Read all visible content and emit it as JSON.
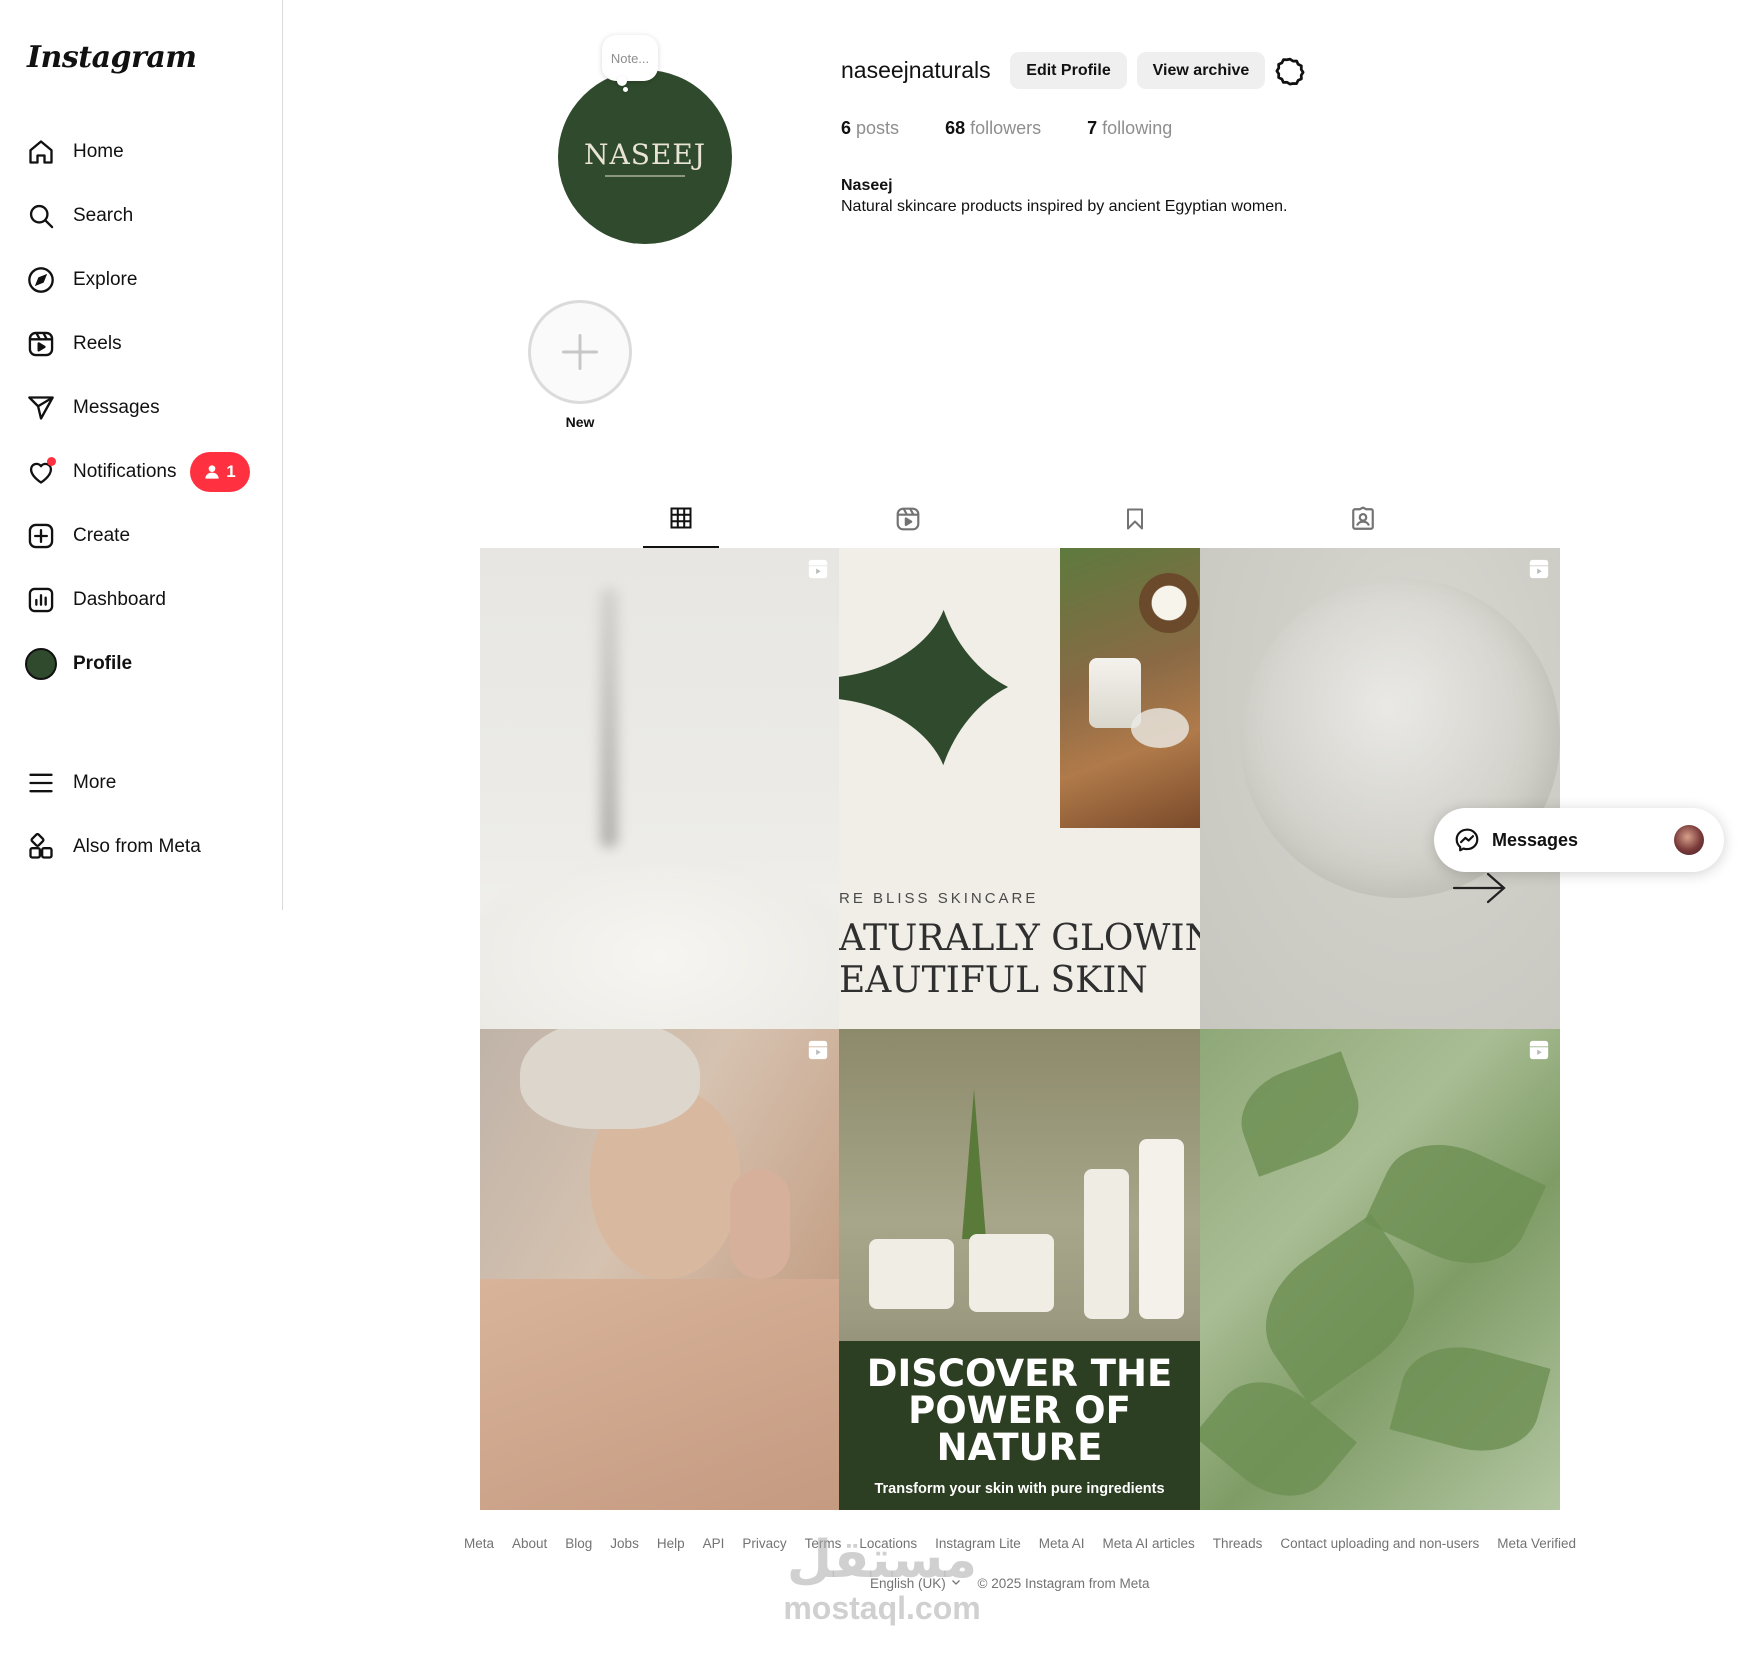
{
  "sidebar": {
    "logo": "Instagram",
    "items": [
      {
        "label": "Home",
        "icon": "home-icon"
      },
      {
        "label": "Search",
        "icon": "search-icon"
      },
      {
        "label": "Explore",
        "icon": "compass-icon"
      },
      {
        "label": "Reels",
        "icon": "reels-icon"
      },
      {
        "label": "Messages",
        "icon": "send-icon"
      },
      {
        "label": "Notifications",
        "icon": "heart-icon"
      },
      {
        "label": "Create",
        "icon": "plus-square-icon"
      },
      {
        "label": "Dashboard",
        "icon": "dashboard-icon"
      },
      {
        "label": "Profile",
        "icon": "avatar"
      }
    ],
    "notification_badge": "1",
    "more_label": "More",
    "also_from_meta_label": "Also from Meta"
  },
  "profile": {
    "note_placeholder": "Note...",
    "avatar_text": "NASEEJ",
    "username": "naseejnaturals",
    "edit_profile_label": "Edit Profile",
    "view_archive_label": "View archive",
    "posts_count": "6",
    "posts_label": "posts",
    "followers_count": "68",
    "followers_label": "followers",
    "following_count": "7",
    "following_label": "following",
    "display_name": "Naseej",
    "bio": "Natural skincare products inspired by ancient Egyptian women.",
    "highlight_new_label": "New"
  },
  "tabs": [
    {
      "name": "posts",
      "icon": "grid-icon",
      "active": true
    },
    {
      "name": "reels",
      "icon": "reels-icon",
      "active": false
    },
    {
      "name": "saved",
      "icon": "bookmark-icon",
      "active": false
    },
    {
      "name": "tagged",
      "icon": "tagged-user-icon",
      "active": false
    }
  ],
  "posts": {
    "post2_subtitle": "RE BLISS SKINCARE",
    "post2_heading_line1": "ATURALLY GLOWIN",
    "post2_heading_line2": "EAUTIFUL SKIN",
    "post5_title_line1": "DISCOVER THE",
    "post5_title_line2": "POWER OF",
    "post5_title_line3": "NATURE",
    "post5_subtitle": "Transform your skin with pure ingredients"
  },
  "messages_pill": {
    "label": "Messages"
  },
  "footer": {
    "links": [
      "Meta",
      "About",
      "Blog",
      "Jobs",
      "Help",
      "API",
      "Privacy",
      "Terms",
      "Locations",
      "Instagram Lite",
      "Meta AI",
      "Meta AI articles",
      "Threads",
      "Contact uploading and non-users",
      "Meta Verified"
    ],
    "language": "English (UK)",
    "copyright": "© 2025 Instagram from Meta"
  },
  "watermark": {
    "arabic": "مستقل",
    "latin": "mostaql.com"
  },
  "colors": {
    "brand_green": "#2f4a2c",
    "badge_red": "#ff3040",
    "muted_text": "#737373"
  }
}
